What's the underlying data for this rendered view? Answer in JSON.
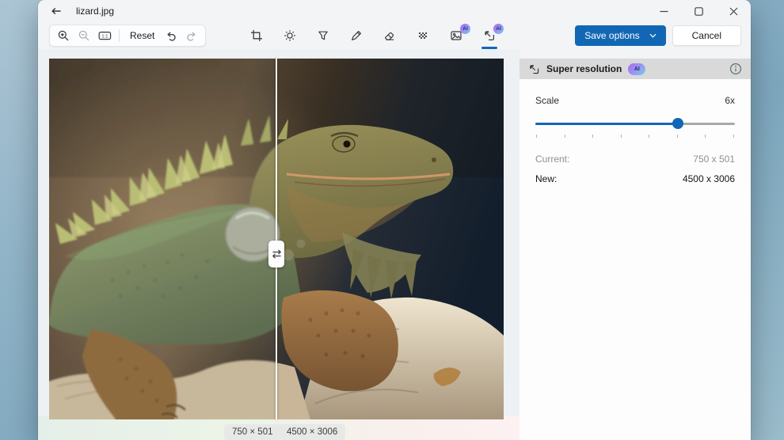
{
  "window": {
    "title": "lizard.jpg",
    "controls": {
      "minimize": "minimize",
      "maximize": "maximize",
      "close": "close"
    }
  },
  "toolbar": {
    "zoom_in_icon": "magnifier-plus",
    "zoom_out_icon": "magnifier-minus",
    "actual_size_label": "1:1",
    "reset_label": "Reset",
    "undo_icon": "undo-arrow",
    "redo_icon": "redo-arrow",
    "tools": [
      {
        "name": "crop",
        "ai": false
      },
      {
        "name": "adjust",
        "ai": false
      },
      {
        "name": "filter",
        "ai": false
      },
      {
        "name": "markup",
        "ai": false
      },
      {
        "name": "retouch",
        "ai": false
      },
      {
        "name": "background",
        "ai": false
      },
      {
        "name": "erase",
        "ai": true
      },
      {
        "name": "super-resolution",
        "ai": true,
        "active": true
      }
    ],
    "ai_badge_label": "AI",
    "save_button_label": "Save options",
    "cancel_label": "Cancel"
  },
  "panel": {
    "title": "Super resolution",
    "ai_badge": "AI",
    "scale_label": "Scale",
    "scale_value": "6x",
    "slider": {
      "min": 1,
      "max": 8,
      "value": 6,
      "tick_count": 8
    },
    "current_label": "Current:",
    "current_value": "750 x 501",
    "new_label": "New:",
    "new_value": "4500 x 3006"
  },
  "viewer": {
    "subject": "iguana-photo-before-after-comparison",
    "before_size_label": "750 × 501",
    "after_size_label": "4500 × 3006"
  },
  "colors": {
    "accent": "#1267b4",
    "ai_badge_gradient_from": "#a873f2",
    "ai_badge_gradient_to": "#7fc2ee",
    "panel_header_bg": "#d9d9d9",
    "window_bg": "#f2f4f6"
  }
}
